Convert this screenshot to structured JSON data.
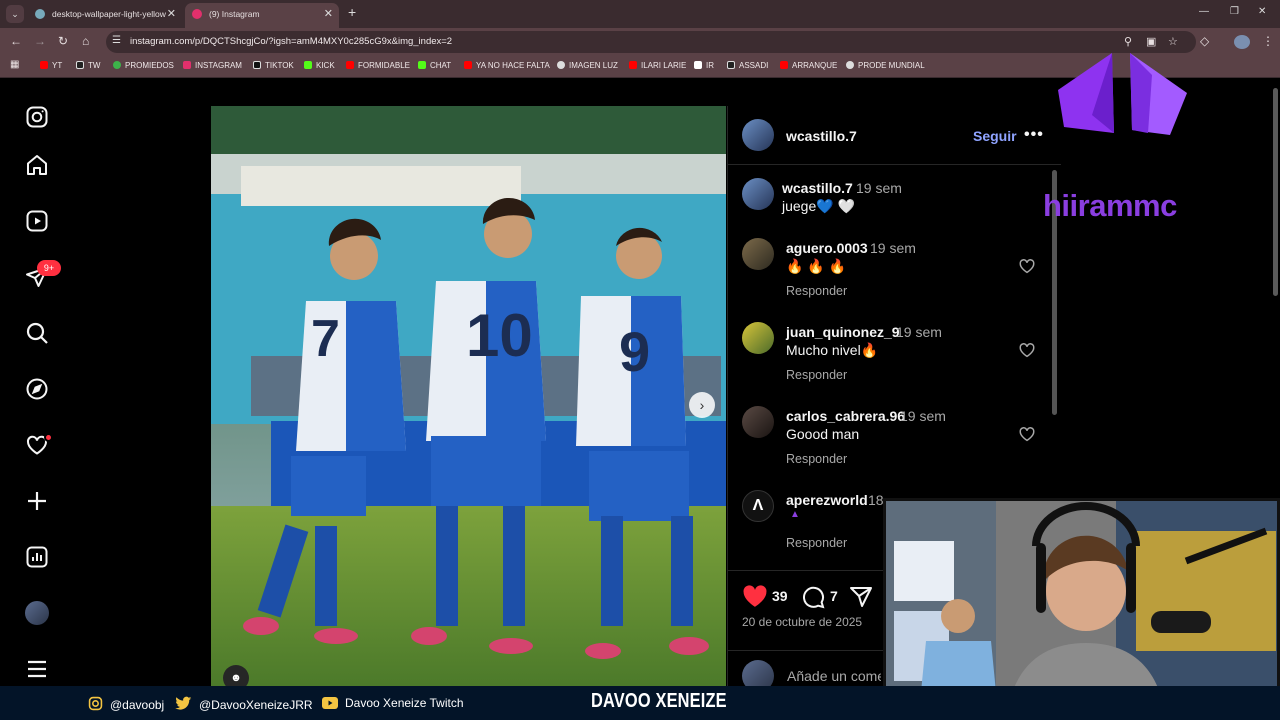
{
  "browser": {
    "tabs": [
      {
        "label": "desktop-wallpaper-light-yellow"
      },
      {
        "label": "(9) Instagram"
      }
    ],
    "url": "instagram.com/p/DQCTShcgjCo/?igsh=amM4MXY0c285cG9x&img_index=2",
    "bookmarks": [
      {
        "label": "YT",
        "color": "#ff0000"
      },
      {
        "label": "TW",
        "color": "#ffffff"
      },
      {
        "label": "PROMIEDOS",
        "color": "#3db34a"
      },
      {
        "label": "INSTAGRAM",
        "color": "#e1306c"
      },
      {
        "label": "TIKTOK",
        "color": "#ffffff"
      },
      {
        "label": "KICK",
        "color": "#53fc18"
      },
      {
        "label": "FORMIDABLE",
        "color": "#ff0000"
      },
      {
        "label": "CHAT",
        "color": "#53fc18"
      },
      {
        "label": "YA NO HACE FALTA",
        "color": "#ff0000"
      },
      {
        "label": "IMAGEN LUZ",
        "color": "#dddddd"
      },
      {
        "label": "ILARI LARIE",
        "color": "#ff0000"
      },
      {
        "label": "IR",
        "color": "#ffffff"
      },
      {
        "label": "ASSADI",
        "color": "#ffffff"
      },
      {
        "label": "ARRANQUE",
        "color": "#ff0000"
      },
      {
        "label": "PRODE MUNDIAL",
        "color": "#dddddd"
      }
    ]
  },
  "sidebar": {
    "notification_badge": "9+"
  },
  "post": {
    "author": "wcastillo.7",
    "follow_label": "Seguir",
    "more_label": "•••",
    "caption": {
      "user": "wcastillo.7",
      "time": "19 sem",
      "text": "juege💙 🤍"
    },
    "comments": [
      {
        "user": "aguero.0003",
        "time": "19 sem",
        "text": "🔥 🔥 🔥",
        "reply": "Responder"
      },
      {
        "user": "juan_quinonez_9",
        "time": "19 sem",
        "text": "Mucho nivel🔥",
        "reply": "Responder"
      },
      {
        "user": "carlos_cabrera.96",
        "time": "19 sem",
        "text": "Goood man",
        "reply": "Responder"
      },
      {
        "user": "aperezworld",
        "time": "18",
        "text": "",
        "reply": "Responder"
      }
    ],
    "likes": "39",
    "comment_count": "7",
    "date": "20 de octubre de 2025",
    "add_comment_placeholder": "Añade un comentario..."
  },
  "overlay": {
    "brand_text": "hiirammc",
    "socials": [
      {
        "label": "@davoobj"
      },
      {
        "label": "@DavooXeneizeJRR"
      },
      {
        "label": "Davoo Xeneize Twitch"
      }
    ],
    "banner": "DAVOO XENEIZE"
  },
  "colors": {
    "accent_follow": "#8fa3ff",
    "like_red": "#ff3040",
    "brand_purple": "#8a3ee0"
  }
}
